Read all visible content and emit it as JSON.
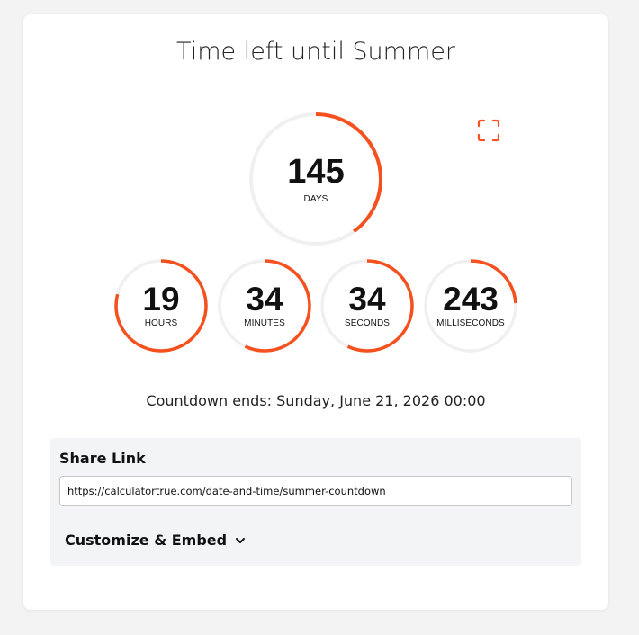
{
  "title": "Time left until Summer",
  "colors": {
    "accent": "#f4511e",
    "track": "#f0f0f0"
  },
  "icons": {
    "fullscreen": "fullscreen-icon",
    "chevron": "chevron-down-icon"
  },
  "countdown": {
    "days": {
      "value": "145",
      "label": "DAYS",
      "progress": 0.4
    },
    "hours": {
      "value": "19",
      "label": "HOURS",
      "progress": 0.79
    },
    "minutes": {
      "value": "34",
      "label": "MINUTES",
      "progress": 0.57
    },
    "seconds": {
      "value": "34",
      "label": "SECONDS",
      "progress": 0.57
    },
    "milliseconds": {
      "value": "243",
      "label": "MILLISECONDS",
      "progress": 0.24
    }
  },
  "ends_text": "Countdown ends: Sunday, June 21, 2026 00:00",
  "share": {
    "title": "Share Link",
    "url": "https://calculatortrue.com/date-and-time/summer-countdown"
  },
  "customize": {
    "label": "Customize & Embed"
  }
}
